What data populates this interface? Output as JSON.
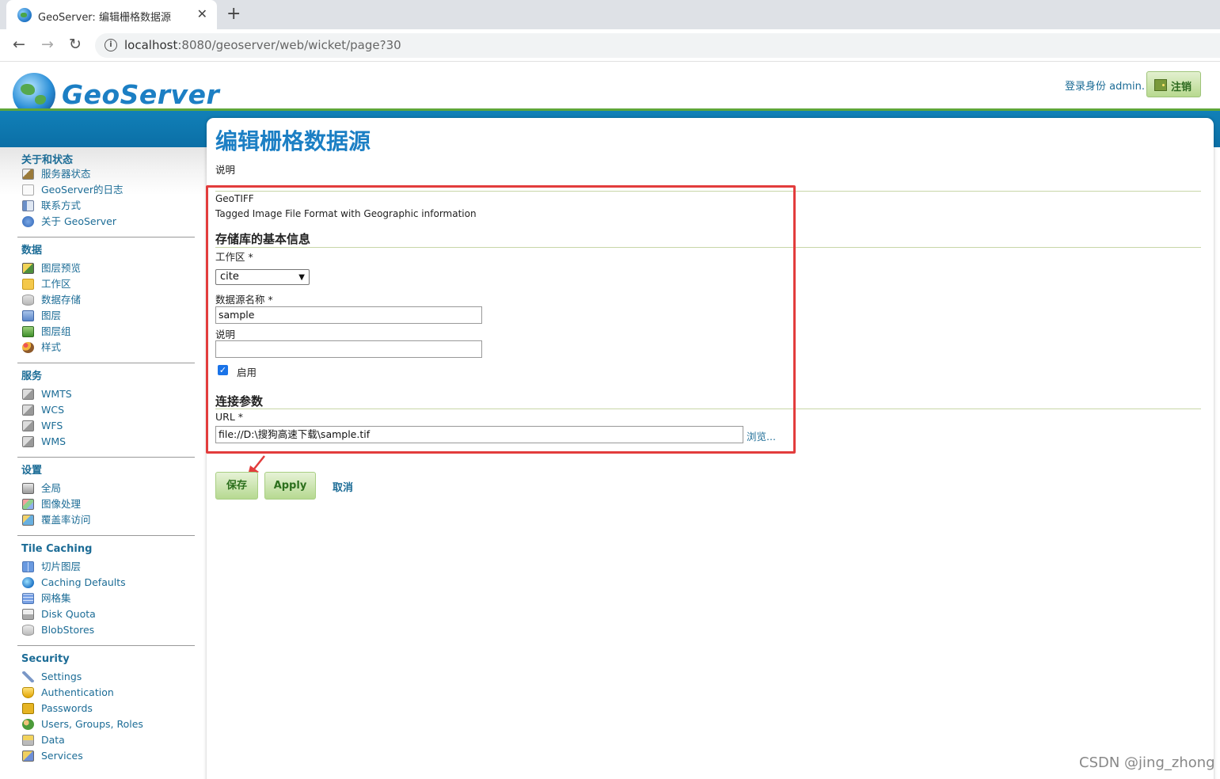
{
  "browser": {
    "tab_title": "GeoServer: 编辑栅格数据源",
    "tab_close": "✕",
    "new_tab": "+",
    "back": "←",
    "forward": "→",
    "reload": "↻",
    "info": "i",
    "url_host": "localhost",
    "url_rest": ":8080/geoserver/web/wicket/page?30"
  },
  "header": {
    "logo_text": "GeoServer",
    "login_label": "登录身份 admin.",
    "logout_label": "注销"
  },
  "sidebar": {
    "sections": [
      {
        "title": "关于和状态",
        "items": [
          {
            "label": "服务器状态",
            "icon": "server-status-icon"
          },
          {
            "label": "GeoServer的日志",
            "icon": "log-icon"
          },
          {
            "label": "联系方式",
            "icon": "contact-icon"
          },
          {
            "label": "关于 GeoServer",
            "icon": "about-icon"
          }
        ]
      },
      {
        "title": "数据",
        "items": [
          {
            "label": "图层预览",
            "icon": "layer-preview-icon"
          },
          {
            "label": "工作区",
            "icon": "folder-icon"
          },
          {
            "label": "数据存储",
            "icon": "store-icon"
          },
          {
            "label": "图层",
            "icon": "layer-icon"
          },
          {
            "label": "图层组",
            "icon": "layer-group-icon"
          },
          {
            "label": "样式",
            "icon": "style-icon"
          }
        ]
      },
      {
        "title": "服务",
        "items": [
          {
            "label": "WMTS",
            "icon": "service-icon"
          },
          {
            "label": "WCS",
            "icon": "service-icon"
          },
          {
            "label": "WFS",
            "icon": "service-icon"
          },
          {
            "label": "WMS",
            "icon": "service-icon"
          }
        ]
      },
      {
        "title": "设置",
        "items": [
          {
            "label": "全局",
            "icon": "global-settings-icon"
          },
          {
            "label": "图像处理",
            "icon": "image-processing-icon"
          },
          {
            "label": "覆盖率访问",
            "icon": "coverage-access-icon"
          }
        ]
      },
      {
        "title": "Tile Caching",
        "items": [
          {
            "label": "切片图层",
            "icon": "tile-layer-icon"
          },
          {
            "label": "Caching Defaults",
            "icon": "globe-icon"
          },
          {
            "label": "网格集",
            "icon": "gridset-icon"
          },
          {
            "label": "Disk Quota",
            "icon": "disk-icon"
          },
          {
            "label": "BlobStores",
            "icon": "blobstore-icon"
          }
        ]
      },
      {
        "title": "Security",
        "items": [
          {
            "label": "Settings",
            "icon": "key-icon"
          },
          {
            "label": "Authentication",
            "icon": "shield-icon"
          },
          {
            "label": "Passwords",
            "icon": "lock-icon"
          },
          {
            "label": "Users, Groups, Roles",
            "icon": "users-icon"
          },
          {
            "label": "Data",
            "icon": "data-security-icon"
          },
          {
            "label": "Services",
            "icon": "services-security-icon"
          }
        ]
      }
    ]
  },
  "main": {
    "title": "编辑栅格数据源",
    "description": "说明",
    "store_type": "GeoTIFF",
    "store_type_description": "Tagged Image File Format with Geographic information",
    "basic_info_heading": "存储库的基本信息",
    "workspace_label": "工作区 *",
    "workspace_value": "cite",
    "name_label": "数据源名称 *",
    "name_value": "sample",
    "desc_label": "说明",
    "desc_value": "",
    "enabled_label": "启用",
    "enabled": true,
    "conn_heading": "连接参数",
    "url_label": "URL *",
    "url_value": "file://D:\\搜狗高速下载\\sample.tif",
    "browse_label": "浏览...",
    "save_label": "保存",
    "apply_label": "Apply",
    "cancel_label": "取消"
  },
  "watermark": "CSDN @jing_zhong",
  "colors": {
    "accent_blue": "#1c7fc4",
    "link_blue": "#1c6c96",
    "header_band": "#0b6fa6",
    "green_rule": "#5ea63a",
    "annotation_red": "#e23c3c"
  }
}
